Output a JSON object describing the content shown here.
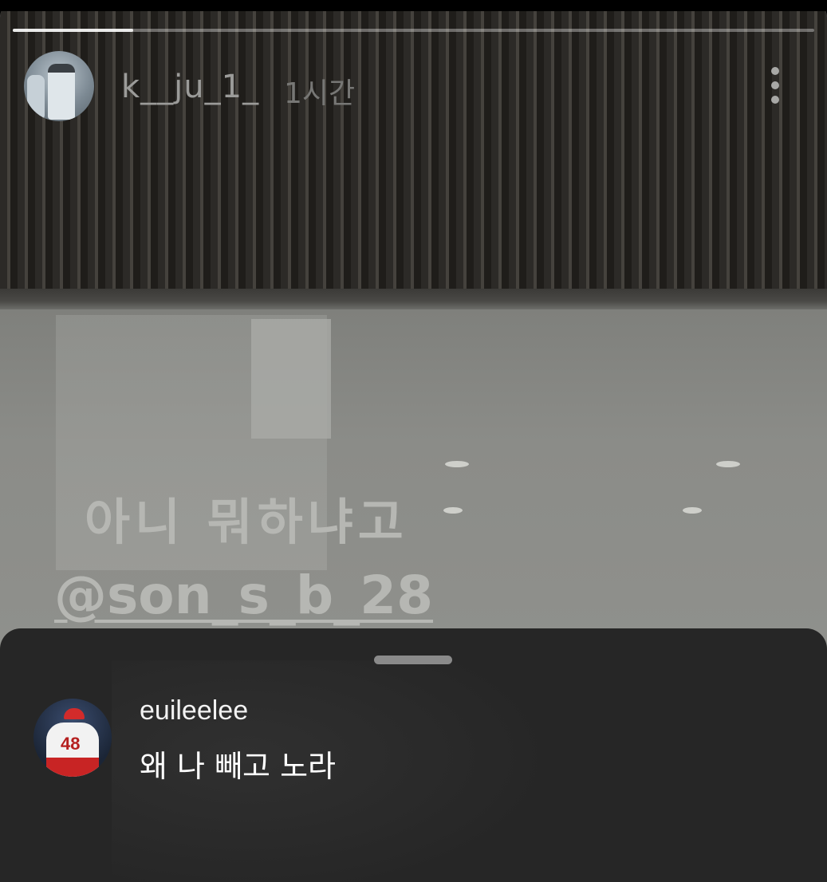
{
  "story": {
    "progress": 0.15,
    "username": "k__ju_1_",
    "time_ago": "1시간",
    "overlay_text": "아니 뭐하냐고",
    "mention": "@son_s_b_28"
  },
  "reply_sheet": {
    "username": "euileelee",
    "message": "왜 나 빼고 노라",
    "avatar_jersey_number": "48"
  },
  "icons": {
    "more": "more-vertical-icon"
  }
}
